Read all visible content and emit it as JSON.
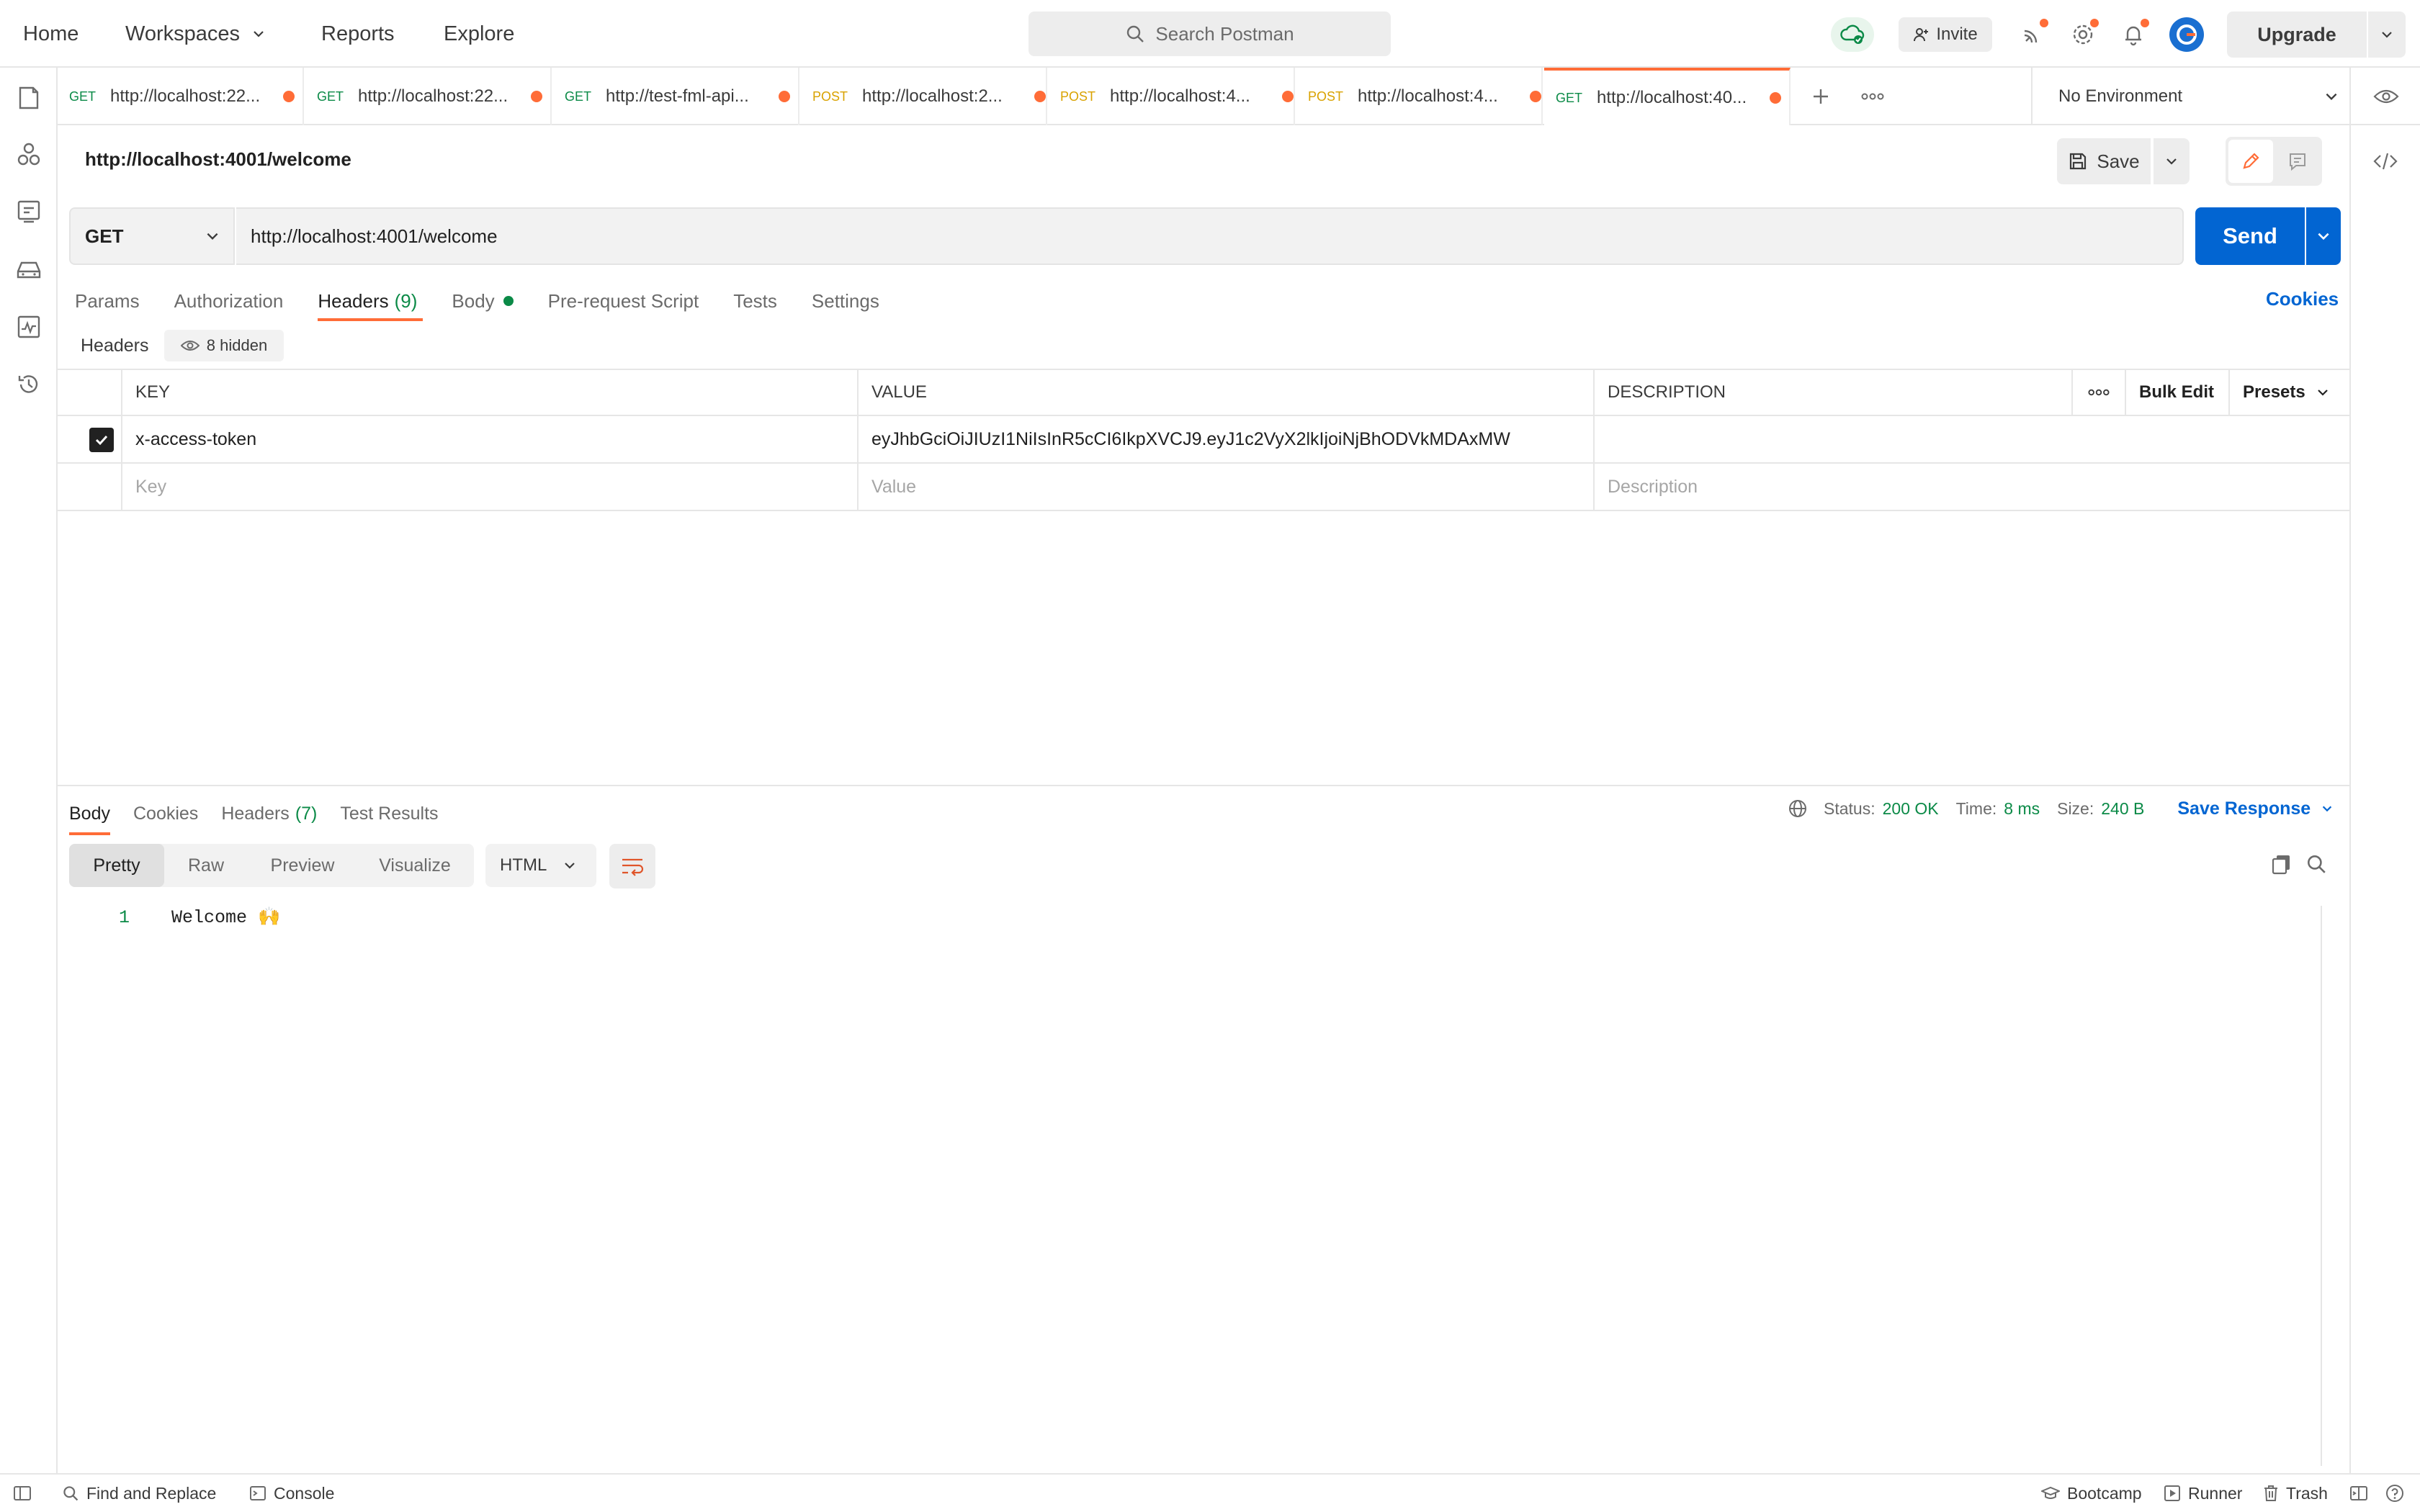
{
  "topbar": {
    "home": "Home",
    "workspaces": "Workspaces",
    "reports": "Reports",
    "explore": "Explore",
    "search_placeholder": "Search Postman",
    "invite": "Invite",
    "upgrade": "Upgrade"
  },
  "tabs": [
    {
      "method": "GET",
      "url": "http://localhost:22..."
    },
    {
      "method": "GET",
      "url": "http://localhost:22..."
    },
    {
      "method": "GET",
      "url": "http://test-fml-api..."
    },
    {
      "method": "POST",
      "url": "http://localhost:2..."
    },
    {
      "method": "POST",
      "url": "http://localhost:4..."
    },
    {
      "method": "POST",
      "url": "http://localhost:4..."
    },
    {
      "method": "GET",
      "url": "http://localhost:40..."
    }
  ],
  "environment": "No Environment",
  "request": {
    "title": "http://localhost:4001/welcome",
    "save": "Save",
    "method": "GET",
    "url": "http://localhost:4001/welcome",
    "send": "Send",
    "tabs": {
      "params": "Params",
      "authorization": "Authorization",
      "headers": "Headers",
      "headers_count": "(9)",
      "body": "Body",
      "pre_request": "Pre-request Script",
      "tests": "Tests",
      "settings": "Settings"
    },
    "cookies": "Cookies",
    "headers_label": "Headers",
    "hidden_label": "8 hidden"
  },
  "headers_table": {
    "columns": {
      "key": "KEY",
      "value": "VALUE",
      "description": "DESCRIPTION"
    },
    "bulk_edit": "Bulk Edit",
    "presets": "Presets",
    "rows": [
      {
        "checked": true,
        "key": "x-access-token",
        "value": "eyJhbGciOiJIUzI1NiIsInR5cCI6IkpXVCJ9.eyJ1c2VyX2lkIjoiNjBhODVkMDAxMW",
        "description": ""
      }
    ],
    "placeholders": {
      "key": "Key",
      "value": "Value",
      "description": "Description"
    }
  },
  "response": {
    "tabs": {
      "body": "Body",
      "cookies": "Cookies",
      "headers": "Headers",
      "headers_count": "(7)",
      "test_results": "Test Results"
    },
    "status_label": "Status:",
    "status": "200 OK",
    "time_label": "Time:",
    "time": "8 ms",
    "size_label": "Size:",
    "size": "240 B",
    "save_response": "Save Response",
    "formats": {
      "pretty": "Pretty",
      "raw": "Raw",
      "preview": "Preview",
      "visualize": "Visualize"
    },
    "language": "HTML",
    "body_lines": [
      {
        "n": "1",
        "text": "Welcome 🙌"
      }
    ]
  },
  "footer": {
    "find_replace": "Find and Replace",
    "console": "Console",
    "bootcamp": "Bootcamp",
    "runner": "Runner",
    "trash": "Trash"
  },
  "colors": {
    "accent": "#ff6c37",
    "primary": "#0265d2",
    "success": "#0b8a47"
  }
}
